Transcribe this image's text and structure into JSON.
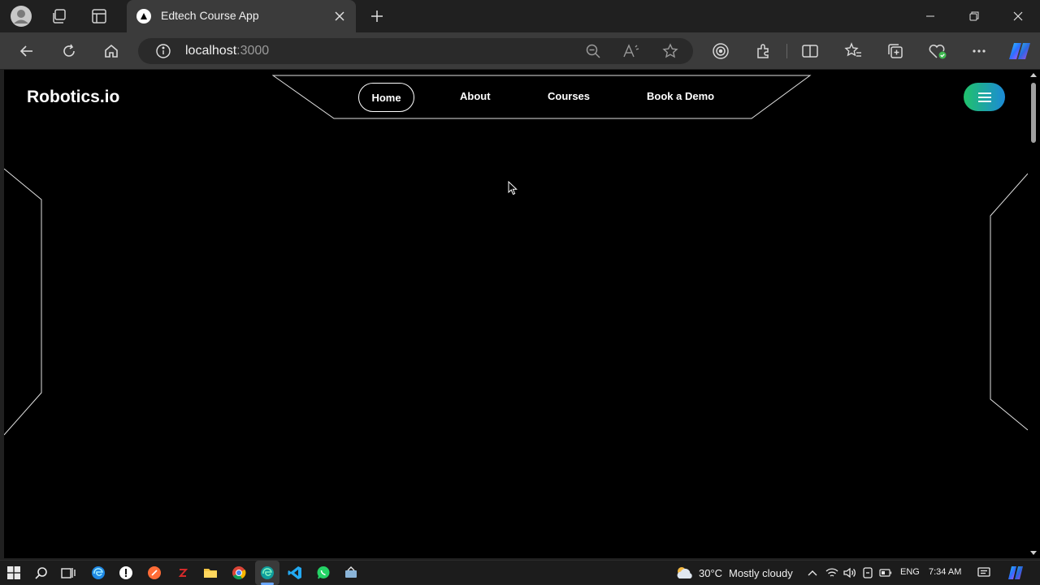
{
  "browser": {
    "tab": {
      "title": "Edtech Course App"
    },
    "address": {
      "host": "localhost",
      "port": ":3000"
    }
  },
  "site": {
    "brand": "Robotics.io",
    "nav": [
      {
        "label": "Home",
        "active": true
      },
      {
        "label": "About"
      },
      {
        "label": "Courses"
      },
      {
        "label": "Book a Demo"
      }
    ],
    "menu_button_gradient": [
      "#20c26a",
      "#1c8ad8"
    ]
  },
  "taskbar": {
    "weather": {
      "temp": "30°C",
      "condition": "Mostly cloudy"
    },
    "language": "ENG",
    "time": "7:34 AM"
  },
  "colors": {
    "page_bg": "#000000",
    "chrome_bg": "#202020",
    "toolbar_bg": "#3b3b3b",
    "accent": "#6aa7ff"
  }
}
